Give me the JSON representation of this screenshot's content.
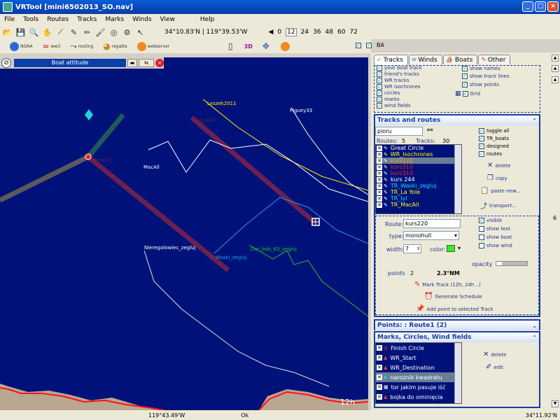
{
  "window": {
    "title": "VRTool [mini6502013_SO.nav]"
  },
  "menu": [
    "File",
    "Tools",
    "Routes",
    "Tracks",
    "Marks",
    "Winds",
    "View",
    "Help"
  ],
  "toolbar": {
    "coordinates": "34°10.83'N | 119°39.53'W",
    "forecast_hours": [
      "0",
      "12",
      "24",
      "36",
      "48",
      "60",
      "72"
    ],
    "forecast_selected": "12"
  },
  "toolbar2": {
    "noaa": "NOAA",
    "ww3": "ww3",
    "routing": "routing",
    "regatta": "regatta",
    "webserver": "webserver",
    "threed": "3D",
    "ba": "BA"
  },
  "map": {
    "boat_attitude_title": "Boat attitude",
    "time_label": "12h",
    "boat_labels": {
      "leszek": "Leszek2011",
      "piguey": "Piguey33",
      "macall": "MacAll",
      "kurs220": "kurs220",
      "kurs310": "kurs310",
      "nieregalowiec": "Nieregalowiec_zegluj",
      "waski": "Waski_zegluj",
      "darbob": "Dar_bob_63_zegluj"
    }
  },
  "panel": {
    "tabs": [
      "Tracks",
      "Winds",
      "Boats",
      "Other"
    ],
    "display_left": [
      "your boat track",
      "friend's tracks",
      "WR tracks",
      "WR isochrones",
      "circles",
      "marks",
      "wind fields"
    ],
    "display_right": [
      "show names",
      "show track lines",
      "show points",
      "Grid"
    ],
    "tracks_routes": {
      "title": "Tracks and routes",
      "search_value": "pioru",
      "routes_label": "Routes:",
      "routes_count": "5",
      "tracks_label": "Tracks:",
      "tracks_count": "30",
      "filters": [
        "toggle all",
        "TR_boats",
        "designed",
        "routes"
      ],
      "list": [
        {
          "name": "Great Circle",
          "color": "#ffffff"
        },
        {
          "name": "WR_Isochrones",
          "color": "#ffff00"
        },
        {
          "name": "kurs220",
          "color": "#ff9900"
        },
        {
          "name": "kurs310",
          "color": "#ff2020"
        },
        {
          "name": "kurs310",
          "color": "#ff2020"
        },
        {
          "name": "kurs 244",
          "color": "#ffffff"
        },
        {
          "name": "TR_Waski_zegluj",
          "color": "#00e0ff"
        },
        {
          "name": "TR_La Yole",
          "color": "#ffff00"
        },
        {
          "name": "TR_lyl",
          "color": "#00e0ff"
        },
        {
          "name": "TR_MacAll",
          "color": "#ffff00"
        }
      ],
      "delete_label": "delete",
      "copy_label": "copy",
      "paste_label": "paste new...",
      "transport_label": "transport...",
      "route_label": "Route:",
      "route_value": "kurs220",
      "type_label": "type:",
      "type_value": "monohull",
      "width_label": "width:",
      "width_value": "7",
      "color_label": "color:",
      "route_color": "#33ee22",
      "visible_options": [
        "visible",
        "show text",
        "show boat",
        "show wind"
      ],
      "opacity_label": "opacity",
      "points_label": "points",
      "points_value": "2",
      "distance_value": "2.3°NM",
      "mark_track": "Mark Track (12h, 24h ..)",
      "generate_schedule": "Generate Schedule",
      "add_point": "Add point to selected Track"
    },
    "points": {
      "title": "Points: : Route1 (2)"
    },
    "marks": {
      "title": "Marks, Circles, Wind fields",
      "items": [
        {
          "name": "Finish Circle",
          "selected": false
        },
        {
          "name": "WR_Start",
          "selected": false
        },
        {
          "name": "WR_Destination",
          "selected": false
        },
        {
          "name": "naroznik kwadratu",
          "selected": true
        },
        {
          "name": "tor jakim pasuje iść",
          "selected": false
        },
        {
          "name": "bojka do ominięcia",
          "selected": false
        }
      ],
      "delete_label": "delete",
      "edit_label": "edit"
    }
  },
  "statusbar": {
    "left_coord": "119°43.49'W",
    "status": "Ok",
    "right_coord": "34°11.92'N"
  },
  "side_number": "6"
}
